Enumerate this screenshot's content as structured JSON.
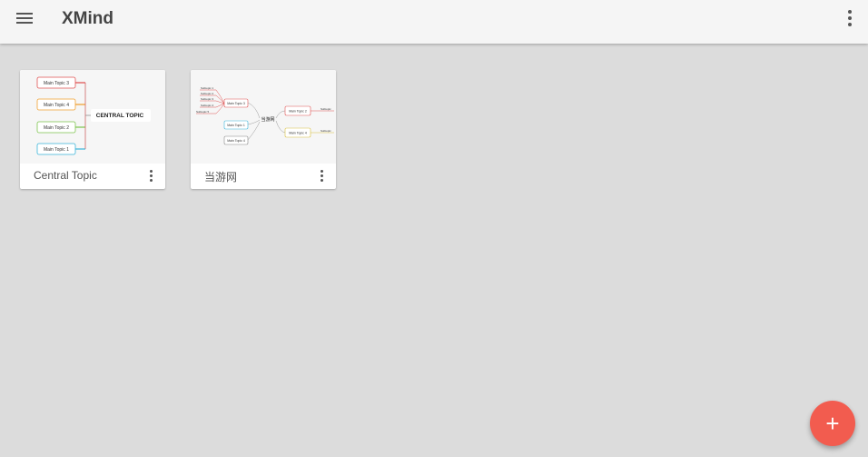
{
  "app": {
    "title": "XMind"
  },
  "icons": {
    "menu": "hamburger-menu-icon",
    "overflow": "more-vertical-icon",
    "fab": "plus-icon"
  },
  "colors": {
    "fab": "#f25c4f",
    "appbar": "#f5f5f5",
    "background": "#dcdcdc"
  },
  "cards": [
    {
      "title": "Central Topic",
      "thumbnail": {
        "central": "CENTRAL TOPIC",
        "topics": [
          "Main Topic 3",
          "Main Topic 4",
          "Main Topic 2",
          "Main Topic 1"
        ]
      }
    },
    {
      "title": "当游网",
      "thumbnail": {
        "central": "当游网",
        "left_topics": [
          "Main Topic 3",
          "Main Topic 1",
          "Main Topic 4"
        ],
        "right_topics": [
          "Main Topic 2",
          "Main Topic 4"
        ],
        "subtopics": [
          "Subtopic 1",
          "Subtopic 2",
          "Subtopic 3",
          "Subtopic 4",
          "Subtopic 5"
        ],
        "right_subtopics": [
          "Subtopic",
          "Subtopic"
        ]
      }
    }
  ],
  "fab": {
    "label": "+"
  }
}
